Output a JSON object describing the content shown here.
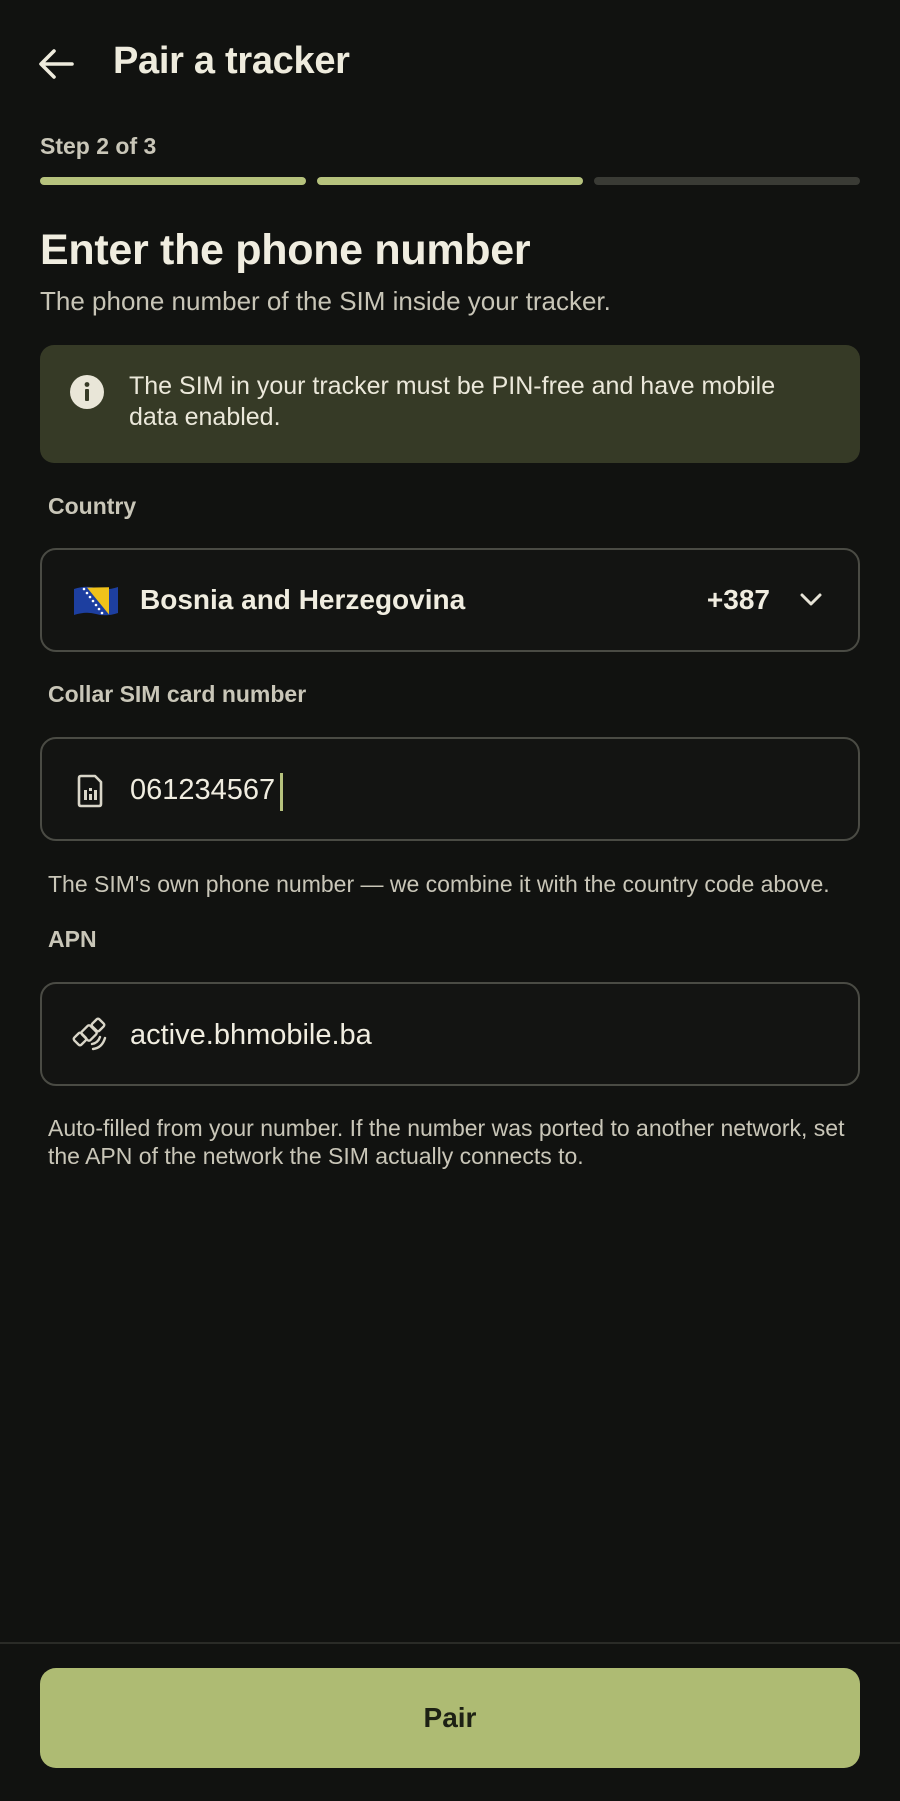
{
  "appbar": {
    "title": "Pair a tracker",
    "back_icon": "arrow-left-icon"
  },
  "stepper": {
    "label": "Step 2 of 3",
    "current_step": 2,
    "total_steps": 3
  },
  "page": {
    "heading": "Enter the phone number",
    "subheading": "The phone number of the SIM inside your tracker."
  },
  "info_banner": {
    "icon": "info-icon",
    "text": "The SIM in your tracker must be PIN-free and have mobile data enabled."
  },
  "country": {
    "label": "Country",
    "flag_icon": "bosnia-flag-icon",
    "name": "Bosnia and Herzegovina",
    "dial_code": "+387",
    "dropdown_icon": "chevron-down-icon"
  },
  "sim_number": {
    "label": "Collar SIM card number",
    "icon": "sim-card-icon",
    "value": "061234567",
    "helper": "The SIM's own phone number — we combine it with the country code above."
  },
  "apn": {
    "label": "APN",
    "icon": "satellite-icon",
    "value": "active.bhmobile.ba",
    "helper": "Auto-filled from your number. If the number was ported to another network, set the APN of the network the SIM actually connects to."
  },
  "actions": {
    "pair_label": "Pair"
  },
  "colors": {
    "accent": "#b6c27d",
    "button": "#aebb73",
    "banner": "#363a26",
    "background": "#111210"
  }
}
